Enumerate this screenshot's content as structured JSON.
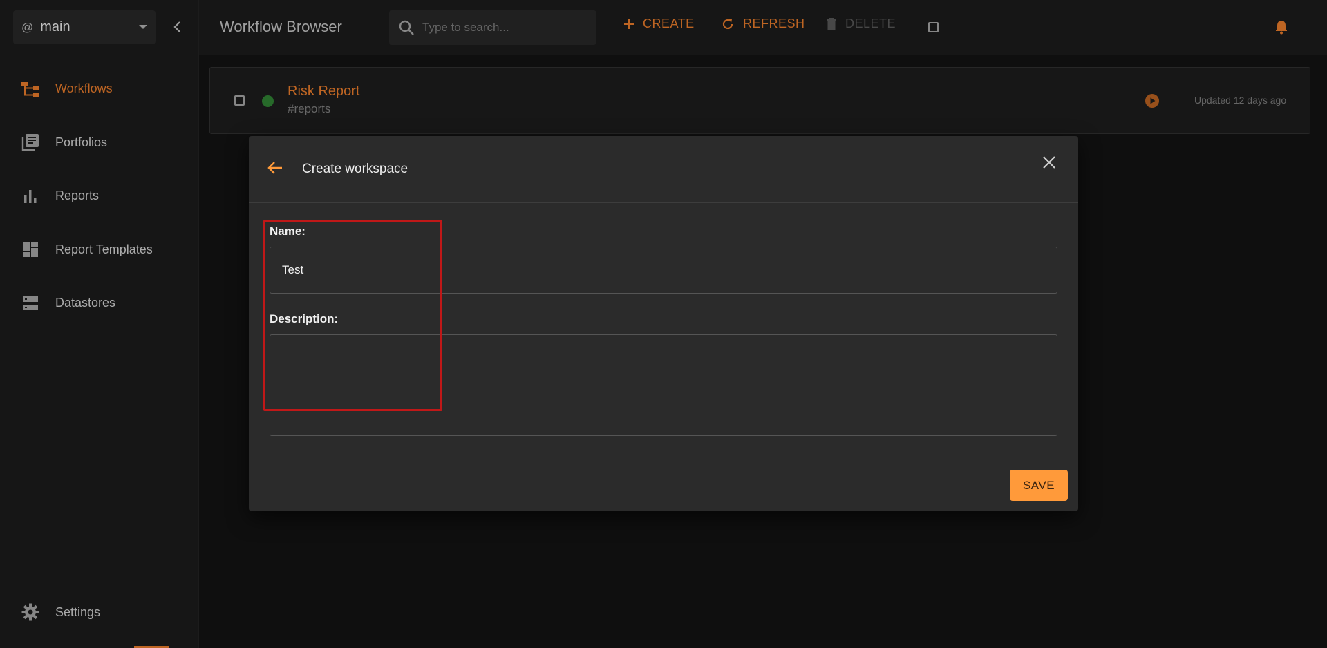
{
  "sidebar": {
    "workspace": {
      "prefix": "@",
      "name": "main"
    },
    "items": [
      {
        "label": "Workflows",
        "icon": "workflow-icon",
        "active": true
      },
      {
        "label": "Portfolios",
        "icon": "library-books-icon",
        "active": false
      },
      {
        "label": "Reports",
        "icon": "bar-chart-icon",
        "active": false
      },
      {
        "label": "Report Templates",
        "icon": "dashboard-icon",
        "active": false
      },
      {
        "label": "Datastores",
        "icon": "storage-icon",
        "active": false
      }
    ],
    "settings": {
      "label": "Settings",
      "icon": "gear-icon"
    }
  },
  "header": {
    "title": "Workflow Browser",
    "search": {
      "placeholder": "Type to search...",
      "value": ""
    },
    "create_label": "CREATE",
    "refresh_label": "REFRESH",
    "delete_label": "DELETE"
  },
  "workflows": [
    {
      "title": "Risk Report",
      "tag": "#reports",
      "updated": "Updated 12 days ago",
      "status": "active"
    }
  ],
  "dialog": {
    "title": "Create workspace",
    "name_label": "Name:",
    "name_value": "Test",
    "description_label": "Description:",
    "description_value": "",
    "save_label": "SAVE"
  },
  "colors": {
    "accent": "#e0772a",
    "save_button": "#ff9a3a",
    "status_green": "#2e7d32",
    "highlight": "#c01818"
  }
}
